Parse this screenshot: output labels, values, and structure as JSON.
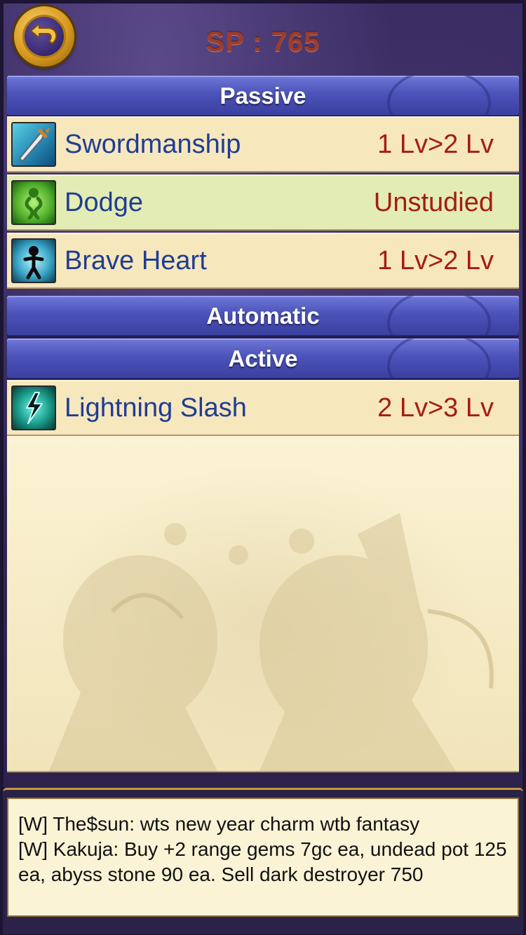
{
  "header": {
    "sp_text": "SP : 765"
  },
  "sections": {
    "passive": "Passive",
    "automatic": "Automatic",
    "active": "Active"
  },
  "passive_skills": [
    {
      "name": "Swordmanship",
      "level": "1 Lv>2 Lv",
      "icon": "sword-icon"
    },
    {
      "name": "Dodge",
      "level": "Unstudied",
      "icon": "dodge-icon"
    },
    {
      "name": "Brave Heart",
      "level": "1 Lv>2 Lv",
      "icon": "brave-heart-icon"
    }
  ],
  "active_skills": [
    {
      "name": "Lightning Slash",
      "level": "2 Lv>3 Lv",
      "icon": "lightning-icon"
    }
  ],
  "chat": {
    "messages": [
      "[W] The$sun: wts new year charm wtb fantasy",
      "[W] Kakuja: Buy +2 range gems 7gc ea, undead pot 125 ea, abyss stone 90 ea. Sell dark destroyer 750"
    ]
  },
  "colors": {
    "skill_name": "#1f3d93",
    "skill_level": "#a51c13",
    "sp_text": "#9a3d2e",
    "section_bg": "#4b52b8",
    "selected_row": "#e3ecb4"
  }
}
